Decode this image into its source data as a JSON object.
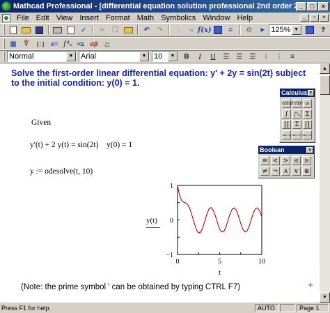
{
  "window": {
    "title": "Mathcad Professional - [differential equation solution professional 2nd order 2.mcd]",
    "min": "_",
    "max": "□",
    "close": "×"
  },
  "menu": {
    "items": [
      "File",
      "Edit",
      "View",
      "Insert",
      "Format",
      "Math",
      "Symbolics",
      "Window",
      "Help"
    ],
    "min": "_",
    "restore": "▫",
    "close": "×"
  },
  "toolbar": {
    "zoom": "125%",
    "assign": "=",
    "eq": "=",
    "question": "?",
    "undo": "↶",
    "redo": "↷",
    "integral": "∫",
    "list": "[:::]",
    "xeq": "x=",
    "sum": "∫ᵈˣ",
    "alpha": "αβ",
    "math_icons": [
      "▦",
      "∜",
      "[:::]",
      "x=",
      "∫ᵈₓ",
      "<≤",
      "αβ",
      "⌂"
    ]
  },
  "format": {
    "style": "Normal",
    "font": "Arial",
    "size": "10",
    "bold": "B",
    "italic": "I",
    "underline": "U"
  },
  "document": {
    "heading": "Solve the first-order linear differential equation:  y' + 2y = sin(2t)    subject to the initial condition: y(0) = 1.",
    "given": "Given",
    "equation": "y'(t) + 2 y(t) = sin(2t)",
    "initial": "y(0) = 1",
    "solve": "y := odesolve(t, 10)",
    "note": "(Note: the prime symbol ' can be obtained by typing CTRL F7)",
    "plus": "+"
  },
  "calculus": {
    "title": "Calculus",
    "close": "×",
    "buttons": [
      "d/dx",
      "dⁿ/dxⁿ",
      "∞",
      "∫",
      "∫ᵇₐ",
      "Σ",
      "∏",
      "Σ",
      "∏",
      "lim→a",
      "lim→a⁺",
      "lim→a⁻"
    ]
  },
  "boolean": {
    "title": "Boolean",
    "close": "×",
    "buttons": [
      "=",
      "<",
      ">",
      "≤",
      "≥",
      "≠",
      "¬",
      "∧",
      "∨",
      "⊕"
    ]
  },
  "chart_data": {
    "type": "line",
    "ylabel": "y(t)",
    "xlabel": "t",
    "xlim": [
      0,
      10
    ],
    "ylim": [
      -1,
      1
    ],
    "xticks": [
      "0",
      "5",
      "10"
    ],
    "yticks": [
      "1",
      "0",
      "−1"
    ],
    "line_color": "#c00000",
    "x": [
      0,
      0.25,
      0.5,
      0.75,
      1,
      1.25,
      1.5,
      1.75,
      2,
      2.25,
      2.5,
      2.75,
      3,
      3.25,
      3.5,
      3.75,
      4,
      4.25,
      4.5,
      4.75,
      5,
      5.25,
      5.5,
      5.75,
      6,
      6.25,
      6.5,
      6.75,
      7,
      7.25,
      7.5,
      7.75,
      8,
      8.25,
      8.5,
      8.75,
      9,
      9.25,
      9.5,
      9.75,
      10
    ],
    "y": [
      1,
      0.71,
      0.56,
      0.51,
      0.49,
      0.43,
      0.3,
      0.1,
      -0.1,
      -0.29,
      -0.38,
      -0.35,
      -0.22,
      -0.02,
      0.18,
      0.33,
      0.36,
      0.27,
      0.11,
      -0.09,
      -0.27,
      -0.35,
      -0.33,
      -0.2,
      0.0,
      0.19,
      0.32,
      0.35,
      0.27,
      0.1,
      -0.1,
      -0.27,
      -0.35,
      -0.32,
      -0.19,
      0.01,
      0.2,
      0.33,
      0.35,
      0.26,
      0.09
    ]
  },
  "status": {
    "help": "Press F1 for help.",
    "mode": "AUTO",
    "page": "Page 1"
  }
}
